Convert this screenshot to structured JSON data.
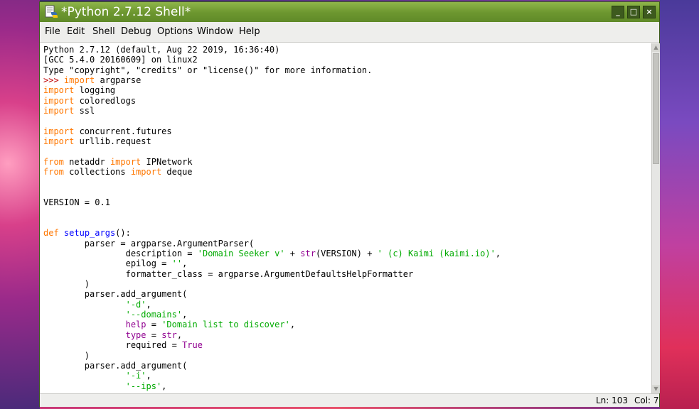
{
  "window": {
    "title": "*Python 2.7.12 Shell*",
    "icon": "python-idle-icon",
    "controls": {
      "minimize": "_",
      "maximize": "□",
      "close": "×"
    }
  },
  "menubar": {
    "items": [
      {
        "label": "File"
      },
      {
        "label": "Edit"
      },
      {
        "label": "Shell"
      },
      {
        "label": "Debug"
      },
      {
        "label": "Options"
      },
      {
        "label": "Window"
      },
      {
        "label": "Help"
      }
    ]
  },
  "editor": {
    "lines": [
      [
        {
          "t": "Python 2.7.12 (default, Aug 22 2019, 16:36:40)",
          "c": "normal"
        }
      ],
      [
        {
          "t": "[GCC 5.4.0 20160609] on linux2",
          "c": "normal"
        }
      ],
      [
        {
          "t": "Type \"copyright\", \"credits\" or \"license()\" for more information.",
          "c": "normal"
        }
      ],
      [
        {
          "t": ">>> ",
          "c": "prompt"
        },
        {
          "t": "import",
          "c": "keyword"
        },
        {
          "t": " argparse",
          "c": "normal"
        }
      ],
      [
        {
          "t": "import",
          "c": "keyword"
        },
        {
          "t": " logging",
          "c": "normal"
        }
      ],
      [
        {
          "t": "import",
          "c": "keyword"
        },
        {
          "t": " coloredlogs",
          "c": "normal"
        }
      ],
      [
        {
          "t": "import",
          "c": "keyword"
        },
        {
          "t": " ssl",
          "c": "normal"
        }
      ],
      [],
      [
        {
          "t": "import",
          "c": "keyword"
        },
        {
          "t": " concurrent.futures",
          "c": "normal"
        }
      ],
      [
        {
          "t": "import",
          "c": "keyword"
        },
        {
          "t": " urllib.request",
          "c": "normal"
        }
      ],
      [],
      [
        {
          "t": "from",
          "c": "keyword"
        },
        {
          "t": " netaddr ",
          "c": "normal"
        },
        {
          "t": "import",
          "c": "keyword"
        },
        {
          "t": " IPNetwork",
          "c": "normal"
        }
      ],
      [
        {
          "t": "from",
          "c": "keyword"
        },
        {
          "t": " collections ",
          "c": "normal"
        },
        {
          "t": "import",
          "c": "keyword"
        },
        {
          "t": " deque",
          "c": "normal"
        }
      ],
      [],
      [],
      [
        {
          "t": "VERSION = 0.1",
          "c": "normal"
        }
      ],
      [],
      [],
      [
        {
          "t": "def",
          "c": "keyword"
        },
        {
          "t": " ",
          "c": "normal"
        },
        {
          "t": "setup_args",
          "c": "def"
        },
        {
          "t": "():",
          "c": "normal"
        }
      ],
      [
        {
          "t": "        parser = argparse.ArgumentParser(",
          "c": "normal"
        }
      ],
      [
        {
          "t": "                description = ",
          "c": "normal"
        },
        {
          "t": "'Domain Seeker v'",
          "c": "string"
        },
        {
          "t": " + ",
          "c": "normal"
        },
        {
          "t": "str",
          "c": "builtin"
        },
        {
          "t": "(VERSION) + ",
          "c": "normal"
        },
        {
          "t": "' (c) Kaimi (kaimi.io)'",
          "c": "string"
        },
        {
          "t": ",",
          "c": "normal"
        }
      ],
      [
        {
          "t": "                epilog = ",
          "c": "normal"
        },
        {
          "t": "''",
          "c": "string"
        },
        {
          "t": ",",
          "c": "normal"
        }
      ],
      [
        {
          "t": "                formatter_class = argparse.ArgumentDefaultsHelpFormatter",
          "c": "normal"
        }
      ],
      [
        {
          "t": "        )",
          "c": "normal"
        }
      ],
      [
        {
          "t": "        parser.add_argument(",
          "c": "normal"
        }
      ],
      [
        {
          "t": "                ",
          "c": "normal"
        },
        {
          "t": "'-d'",
          "c": "string"
        },
        {
          "t": ",",
          "c": "normal"
        }
      ],
      [
        {
          "t": "                ",
          "c": "normal"
        },
        {
          "t": "'--domains'",
          "c": "string"
        },
        {
          "t": ",",
          "c": "normal"
        }
      ],
      [
        {
          "t": "                ",
          "c": "normal"
        },
        {
          "t": "help",
          "c": "builtin"
        },
        {
          "t": " = ",
          "c": "normal"
        },
        {
          "t": "'Domain list to discover'",
          "c": "string"
        },
        {
          "t": ",",
          "c": "normal"
        }
      ],
      [
        {
          "t": "                ",
          "c": "normal"
        },
        {
          "t": "type",
          "c": "builtin"
        },
        {
          "t": " = ",
          "c": "normal"
        },
        {
          "t": "str",
          "c": "builtin"
        },
        {
          "t": ",",
          "c": "normal"
        }
      ],
      [
        {
          "t": "                required = ",
          "c": "normal"
        },
        {
          "t": "True",
          "c": "builtin"
        }
      ],
      [
        {
          "t": "        )",
          "c": "normal"
        }
      ],
      [
        {
          "t": "        parser.add_argument(",
          "c": "normal"
        }
      ],
      [
        {
          "t": "                ",
          "c": "normal"
        },
        {
          "t": "'-i'",
          "c": "string"
        },
        {
          "t": ",",
          "c": "normal"
        }
      ],
      [
        {
          "t": "                ",
          "c": "normal"
        },
        {
          "t": "'--ips'",
          "c": "string"
        },
        {
          "t": ",",
          "c": "normal"
        }
      ]
    ]
  },
  "status": {
    "line": "Ln: 103",
    "col": "Col: 7"
  },
  "colors": {
    "titlebar": "#6e9830",
    "keyword": "#ff7700",
    "builtin": "#900090",
    "string": "#00aa00",
    "definition": "#0000ff",
    "prompt": "#c00000"
  }
}
